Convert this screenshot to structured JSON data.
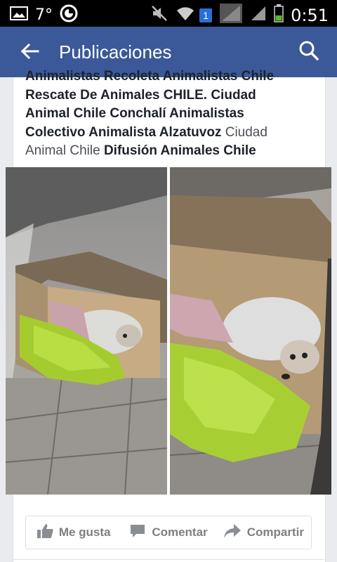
{
  "status_bar": {
    "temperature": "7°",
    "notification_badge": "1",
    "time": "0:51",
    "icons": [
      "image-icon",
      "clock-icon",
      "mute-icon",
      "wifi-icon",
      "no-signal-icon",
      "signal-icon",
      "battery-icon"
    ]
  },
  "app_bar": {
    "title": "Publicaciones",
    "back_icon": "arrow-back-icon",
    "search_icon": "search-icon",
    "color": "#3b5998"
  },
  "post": {
    "text_lines": [
      {
        "bold": "Animalistas Recoleta Animalistas Chile",
        "plain": ""
      },
      {
        "bold": "Rescate De Animales CHILE. Ciudad",
        "plain": ""
      },
      {
        "bold": "Animal Chile Conchalí Animalistas",
        "plain": ""
      },
      {
        "bold": "Colectivo Animalista Alzatuvoz",
        "plain": " Ciudad"
      },
      {
        "plain_start": "Animal Chile ",
        "bold": "Difusión Animales Chile"
      }
    ]
  },
  "actions": {
    "like": "Me gusta",
    "comment": "Comentar",
    "share": "Compartir"
  }
}
